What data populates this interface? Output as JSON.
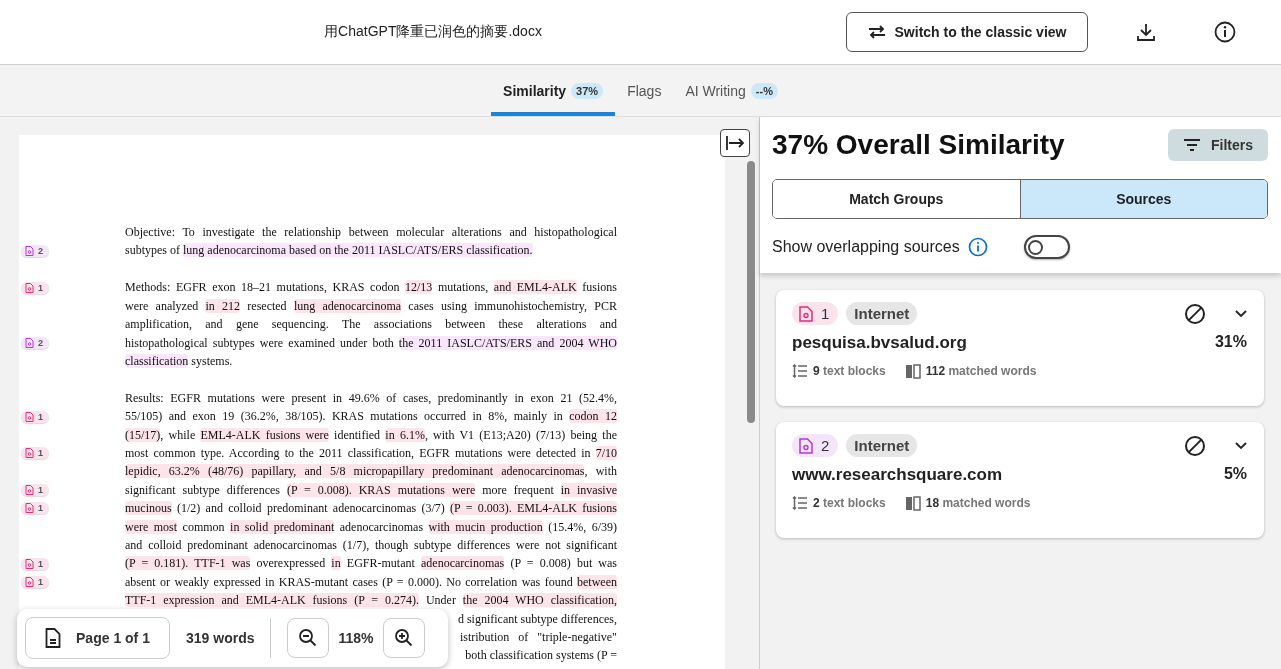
{
  "header": {
    "file_name": "用ChatGPT降重已润色的摘要.docx",
    "switch_button": "Switch to the classic view"
  },
  "tabs": [
    {
      "label": "Similarity",
      "badge": "37%",
      "selected": true
    },
    {
      "label": "Flags",
      "selected": false
    },
    {
      "label": "AI Writing",
      "badge": "--%",
      "selected": false
    }
  ],
  "document": {
    "paragraphs": [
      {
        "lines": [
          {
            "segs": [
              {
                "t": "Objective: To investigate the relationship between molecular alterations and histopathological"
              }
            ]
          },
          {
            "marker": {
              "label": "2",
              "color": "#b03bd0"
            },
            "segs": [
              {
                "t": "subtypes of "
              },
              {
                "t": "lung adenocarcinoma based on the 2011 IASLC/ATS/ERS classification.",
                "color": "#f9e6fa"
              }
            ]
          }
        ]
      },
      {
        "lines": [
          {
            "marker": {
              "label": "1",
              "color": "#d9307a"
            },
            "segs": [
              {
                "t": "Methods: EGFR exon 18–21 mutations, KRAS codon "
              },
              {
                "t": "12/13",
                "color": "#fde3ea"
              },
              {
                "t": " mutations, "
              },
              {
                "t": "and EML4-ALK",
                "color": "#fde3ea"
              },
              {
                "t": " fusions"
              }
            ]
          },
          {
            "segs": [
              {
                "t": "were analyzed "
              },
              {
                "t": "in 212",
                "color": "#fde3ea"
              },
              {
                "t": " resected "
              },
              {
                "t": "lung adenocarcinoma",
                "color": "#fde3ea"
              },
              {
                "t": " cases using immunohistochemistry, PCR"
              }
            ]
          },
          {
            "segs": [
              {
                "t": "amplification, and gene sequencing. The associations between these alterations and"
              }
            ]
          },
          {
            "marker": {
              "label": "2",
              "color": "#b03bd0"
            },
            "segs": [
              {
                "t": "histopathological subtypes were examined under both "
              },
              {
                "t": "the 2011 IASLC/ATS/ERS and 2004 WHO",
                "color": "#f9e6fa"
              }
            ]
          },
          {
            "segs": [
              {
                "t": "classification",
                "color": "#f9e6fa"
              },
              {
                "t": " systems."
              }
            ]
          }
        ]
      },
      {
        "lines": [
          {
            "segs": [
              {
                "t": "Results: EGFR mutations were present in 49.6% of cases, predominantly in exon 21 (52.4%,"
              }
            ]
          },
          {
            "marker": {
              "label": "1",
              "color": "#d9307a"
            },
            "segs": [
              {
                "t": "55/105) and exon 19 (36.2%, 38/105). KRAS mutations occurred in 8%, mainly in "
              },
              {
                "t": "codon 12",
                "color": "#fde3ea"
              }
            ]
          },
          {
            "segs": [
              {
                "t": "(15/17)",
                "color": "#fde3ea"
              },
              {
                "t": ", while "
              },
              {
                "t": "EML4-ALK fusions were",
                "color": "#fde3ea"
              },
              {
                "t": " identified "
              },
              {
                "t": "in 6.1%",
                "color": "#fde3ea"
              },
              {
                "t": ", with V1 (E13;A20) (7/13) being the"
              }
            ]
          },
          {
            "marker": {
              "label": "1",
              "color": "#d9307a"
            },
            "segs": [
              {
                "t": "most common type. According to the 2011 classification, EGFR mutations were detected in "
              },
              {
                "t": "7/10",
                "color": "#fde3ea"
              }
            ]
          },
          {
            "segs": [
              {
                "t": "lepidic, 63.2% (48/76) papillary, and 5/8 micropapillary predominant adenocarcinomas",
                "color": "#fde3ea"
              },
              {
                "t": ", with"
              }
            ]
          },
          {
            "marker": {
              "label": "1",
              "color": "#d9307a"
            },
            "segs": [
              {
                "t": "significant subtype differences "
              },
              {
                "t": "(P = 0.008). KRAS mutations were",
                "color": "#fde3ea"
              },
              {
                "t": " more frequent "
              },
              {
                "t": "in invasive",
                "color": "#fde3ea"
              }
            ]
          },
          {
            "marker": {
              "label": "1",
              "color": "#d9307a"
            },
            "segs": [
              {
                "t": "mucinous",
                "color": "#fde3ea"
              },
              {
                "t": " (1/2) and colloid predominant adenocarcinomas (3/7) "
              },
              {
                "t": "(P = 0.003). EML4-ALK fusions",
                "color": "#fde3ea"
              }
            ]
          },
          {
            "segs": [
              {
                "t": "were most",
                "color": "#fde3ea"
              },
              {
                "t": " common "
              },
              {
                "t": "in solid predominant",
                "color": "#fde3ea"
              },
              {
                "t": " adenocarcinomas "
              },
              {
                "t": "with mucin production",
                "color": "#fde3ea"
              },
              {
                "t": " (15.4%, 6/39)"
              }
            ]
          },
          {
            "segs": [
              {
                "t": "and colloid predominant adenocarcinomas (1/7), though subtype differences were not significant"
              }
            ]
          },
          {
            "marker": {
              "label": "1",
              "color": "#d9307a"
            },
            "segs": [
              {
                "t": "(P = 0.181). TTF-1 was",
                "color": "#fde3ea"
              },
              {
                "t": " overexpressed "
              },
              {
                "t": "in",
                "color": "#fde3ea"
              },
              {
                "t": " EGFR-mutant "
              },
              {
                "t": "adenocarcinomas",
                "color": "#fde3ea"
              },
              {
                "t": " (P = 0.008) but was"
              }
            ]
          },
          {
            "marker": {
              "label": "1",
              "color": "#d9307a"
            },
            "segs": [
              {
                "t": "absent or weakly expressed in KRAS-mutant cases (P = 0.000). No correlation was found "
              },
              {
                "t": "between",
                "color": "#fde3ea"
              }
            ]
          },
          {
            "segs": [
              {
                "t": "TTF-1 expression and EML4-ALK fusions (P = 0.274).",
                "color": "#fde3ea"
              },
              {
                "t": " Under "
              },
              {
                "t": "the 2004 WHO classification,",
                "color": "#fde3ea"
              }
            ]
          },
          {
            "partial": true,
            "segs": [
              {
                "t": "d significant subtype differences,"
              }
            ]
          },
          {
            "partial": true,
            "segs": [
              {
                "t": "istribution   of   \"triple-negative\""
              }
            ]
          },
          {
            "partial": true,
            "segs": [
              {
                "t": "both classification systems (P ="
              }
            ]
          }
        ]
      }
    ]
  },
  "toolbar": {
    "page": "Page 1 of 1",
    "words": "319 words",
    "zoom": "118%"
  },
  "panel": {
    "title": "37% Overall Similarity",
    "filters_button": "Filters",
    "views": [
      {
        "label": "Match Groups",
        "selected": false
      },
      {
        "label": "Sources",
        "selected": true
      }
    ],
    "overlap": {
      "label": "Show overlapping sources",
      "on": false
    },
    "sources": [
      {
        "number": "1",
        "color": "#d9307a",
        "type": "Internet",
        "name": "pesquisa.bvsalud.org",
        "percent": "31%",
        "blocks": "**9** text blocks",
        "matched": "**112** matched words"
      },
      {
        "number": "2",
        "color": "#b03bd0",
        "type": "Internet",
        "name": "www.researchsquare.com",
        "percent": "5%",
        "blocks": "**2** text blocks",
        "matched": "**18** matched words"
      }
    ]
  }
}
